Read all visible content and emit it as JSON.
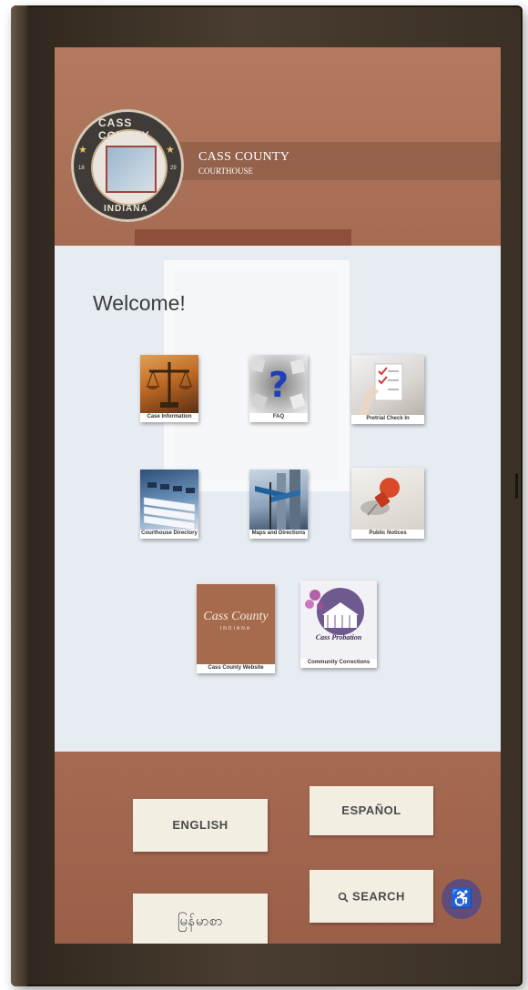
{
  "header": {
    "seal_top_text": "CASS COUNTY",
    "seal_bottom_text": "INDIANA",
    "seal_year_left": "18",
    "seal_year_right": "29",
    "brand_title": "CASS COUNTY",
    "brand_subtitle": "COURTHOUSE"
  },
  "main": {
    "welcome": "Welcome!",
    "tiles": [
      {
        "label": "Case Information",
        "icon": "scales-of-justice-photo"
      },
      {
        "label": "FAQ",
        "icon": "question-mark-photo"
      },
      {
        "label": "Pretrial Check In",
        "icon": "checklist-photo"
      },
      {
        "label": "Courthouse Directory",
        "icon": "file-folders-photo"
      },
      {
        "label": "Maps and Directions",
        "icon": "street-sign-photo"
      },
      {
        "label": "Public Notices",
        "icon": "pushpin-photo"
      },
      {
        "label": "Cass County Website",
        "icon": "cass-county-logo",
        "logo_text": "Cass County",
        "logo_subtext": "INDIANA"
      },
      {
        "label": "Community Corrections",
        "icon": "community-corrections-logo",
        "logo_text": "Cass Probation"
      }
    ]
  },
  "footer": {
    "english": "ENGLISH",
    "espanol": "ESPAÑOL",
    "burmese": "မြန်မာစာ",
    "search": "SEARCH",
    "search_icon": "magnifier-icon",
    "accessibility_icon": "wheelchair-icon"
  },
  "colors": {
    "frame": "#3a3026",
    "screen_brown": "#a8715a",
    "content_bg": "#e7ecf2",
    "button_bg": "#f2efe2",
    "accessibility": "#5f4c7a"
  }
}
